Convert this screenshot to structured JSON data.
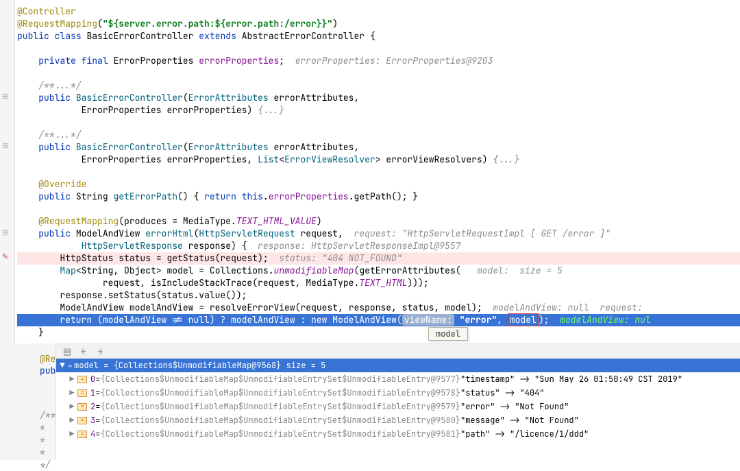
{
  "code": {
    "ann_controller": "@Controller",
    "ann_reqmap": "@RequestMapping",
    "ann_reqmap_arg": "\"${server.error.path:${error.path:/error}}\"",
    "public": "public",
    "class": "class",
    "classname": "BasicErrorController",
    "extends": "extends",
    "superclass": "AbstractErrorController",
    "brace_open": "{",
    "private": "private",
    "final": "final",
    "type_errprops": "ErrorProperties",
    "field_errprops": "errorProperties",
    "hint_errprops": "errorProperties: ErrorProperties@9203",
    "javadoc_fold": "/**...*/",
    "ctor_name": "BasicErrorController",
    "type_errattrs": "ErrorAttributes",
    "param_errattrs": "errorAttributes",
    "param_errprops": "errorProperties",
    "fold_body": "{...}",
    "type_list": "List",
    "type_evr": "ErrorViewResolver",
    "param_evrs": "errorViewResolvers",
    "ann_override": "@Override",
    "type_string": "String",
    "mth_geterrpath": "getErrorPath",
    "return": "return",
    "this": "this",
    "mth_getpath": "getPath",
    "produces": "produces",
    "mediatype": "MediaType",
    "const_texthtml": "TEXT_HTML_VALUE",
    "type_mav": "ModelAndView",
    "mth_errhtml": "errorHtml",
    "type_req": "HttpServletRequest",
    "param_req": "request",
    "hint_req": "request: \"HttpServletRequestImpl [ GET /error ]\"",
    "type_resp": "HttpServletResponse",
    "param_resp": "response",
    "hint_resp": "response: HttpServletResponseImpl@9557",
    "type_httpstatus": "HttpStatus",
    "var_status": "status",
    "mth_getstatus": "getStatus",
    "hint_status": "status: \"404 NOT_FOUND\"",
    "type_map": "Map",
    "type_object": "Object",
    "var_model": "model",
    "cls_collections": "Collections",
    "mth_unmod": "unmodifiableMap",
    "mth_geterrattrs": "getErrorAttributes",
    "hint_model": "model:  size = 5",
    "mth_isincl": "isIncludeStackTrace",
    "const_texthtml2": "TEXT_HTML",
    "mth_setstatus": "setStatus",
    "mth_value": "value",
    "var_mav": "modelAndView",
    "mth_resolve": "resolveErrorView",
    "hint_mav": "modelAndView: null  request:",
    "label_viewname": "viewName:",
    "str_error": "\"error\"",
    "sel_model": "model",
    "hint_selline": "modelAndView: nul",
    "tooltip": "model",
    "brace_close": "}",
    "at_re": "@Re",
    "pub_l": "publ",
    "slashdoubleast": "/**",
    "star": " *",
    "starslash": " */"
  },
  "debug": {
    "root_label": "model = {Collections$UnmodifiableMap@9568}  size = 5",
    "rows": [
      {
        "idx": "0",
        "obj": "{Collections$UnmodifiableMap$UnmodifiableEntrySet$UnmodifiableEntry@9577}",
        "val": "\"timestamp\" -> \"Sun May 26 01:50:49 CST 2019\""
      },
      {
        "idx": "1",
        "obj": "{Collections$UnmodifiableMap$UnmodifiableEntrySet$UnmodifiableEntry@9578}",
        "val": "\"status\" -> \"404\""
      },
      {
        "idx": "2",
        "obj": "{Collections$UnmodifiableMap$UnmodifiableEntrySet$UnmodifiableEntry@9579}",
        "val": "\"error\" -> \"Not Found\""
      },
      {
        "idx": "3",
        "obj": "{Collections$UnmodifiableMap$UnmodifiableEntrySet$UnmodifiableEntry@9580}",
        "val": "\"message\" -> \"Not Found\""
      },
      {
        "idx": "4",
        "obj": "{Collections$UnmodifiableMap$UnmodifiableEntrySet$UnmodifiableEntry@9581}",
        "val": "\"path\" -> \"/licence/1/ddd\""
      }
    ]
  }
}
